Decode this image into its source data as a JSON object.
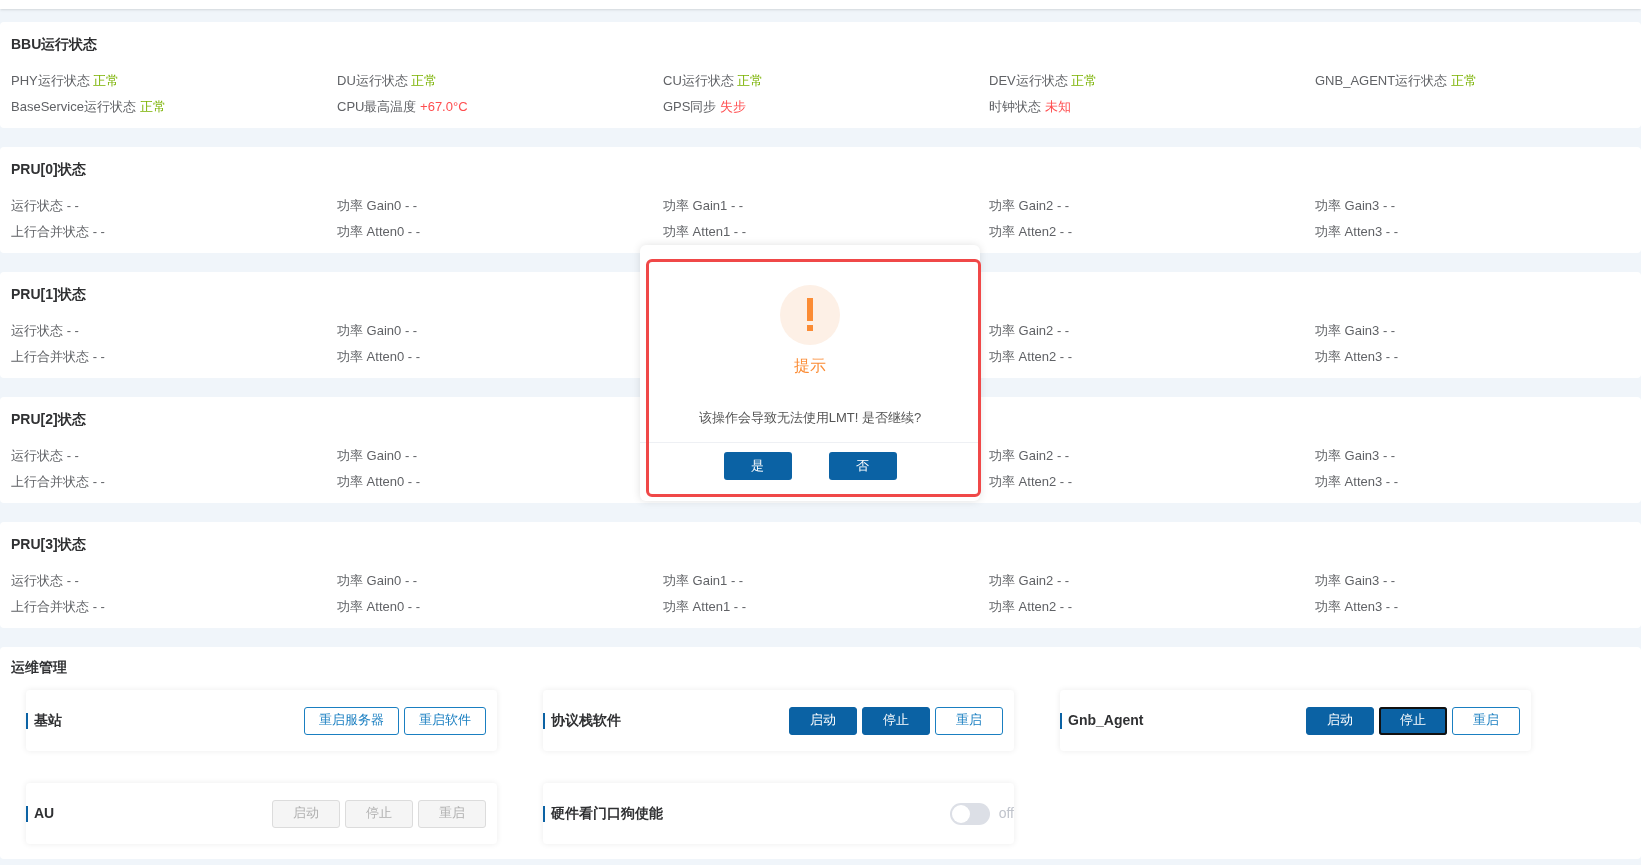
{
  "status_panels": [
    {
      "title": "BBU运行状态",
      "partly_hidden": false,
      "rows": [
        [
          {
            "label": "PHY运行状态",
            "value": "正常",
            "kind": "normal"
          },
          {
            "label": "DU运行状态",
            "value": "正常",
            "kind": "normal"
          },
          {
            "label": "CU运行状态",
            "value": "正常",
            "kind": "normal"
          },
          {
            "label": "DEV运行状态",
            "value": "正常",
            "kind": "normal"
          },
          {
            "label": "GNB_AGENT运行状态",
            "value": "正常",
            "kind": "normal"
          }
        ],
        [
          {
            "label": "BaseService运行状态",
            "value": "正常",
            "kind": "normal"
          },
          {
            "label": "CPU最高温度",
            "value": "+67.0°C",
            "kind": "alarm"
          },
          {
            "label": "GPS同步",
            "value": "失步",
            "kind": "alarm"
          },
          {
            "label": "时钟状态",
            "value": "未知",
            "kind": "alarm"
          }
        ]
      ]
    },
    {
      "title": "PRU[0]状态",
      "partly_hidden": false,
      "rows": [
        [
          {
            "label": "运行状态",
            "value": "- -",
            "kind": "empty"
          },
          {
            "label": "功率 Gain0",
            "value": "- -",
            "kind": "empty"
          },
          {
            "label": "功率 Gain1",
            "value": "- -",
            "kind": "empty"
          },
          {
            "label": "功率 Gain2",
            "value": "- -",
            "kind": "empty"
          },
          {
            "label": "功率 Gain3",
            "value": "- -",
            "kind": "empty"
          }
        ],
        [
          {
            "label": "上行合并状态",
            "value": "- -",
            "kind": "empty"
          },
          {
            "label": "功率 Atten0",
            "value": "- -",
            "kind": "empty"
          },
          {
            "label": "功率 Atten1",
            "value": "- -",
            "kind": "empty"
          },
          {
            "label": "功率 Atten2",
            "value": "- -",
            "kind": "empty"
          },
          {
            "label": "功率 Atten3",
            "value": "- -",
            "kind": "empty"
          }
        ]
      ]
    },
    {
      "title": "PRU[1]状态",
      "partly_hidden": true,
      "rows": [
        [
          {
            "label": "运行状态",
            "value": "- -",
            "kind": "empty"
          },
          {
            "label": "功率 Gain0",
            "value": "- -",
            "kind": "empty"
          },
          {
            "label": "功率 Gain2",
            "value": "- -",
            "kind": "empty"
          },
          {
            "label": "功率 Gain3",
            "value": "- -",
            "kind": "empty"
          }
        ],
        [
          {
            "label": "上行合并状态",
            "value": "- -",
            "kind": "empty"
          },
          {
            "label": "功率 Atten0",
            "value": "- -",
            "kind": "empty"
          },
          {
            "label": "功率 Atten2",
            "value": "- -",
            "kind": "empty"
          },
          {
            "label": "功率 Atten3",
            "value": "- -",
            "kind": "empty"
          }
        ]
      ]
    },
    {
      "title": "PRU[2]状态",
      "partly_hidden": true,
      "rows": [
        [
          {
            "label": "运行状态",
            "value": "- -",
            "kind": "empty"
          },
          {
            "label": "功率 Gain0",
            "value": "- -",
            "kind": "empty"
          },
          {
            "label": "功率 Gain2",
            "value": "- -",
            "kind": "empty"
          },
          {
            "label": "功率 Gain3",
            "value": "- -",
            "kind": "empty"
          }
        ],
        [
          {
            "label": "上行合并状态",
            "value": "- -",
            "kind": "empty"
          },
          {
            "label": "功率 Atten0",
            "value": "- -",
            "kind": "empty"
          },
          {
            "label": "功率 Atten2",
            "value": "- -",
            "kind": "empty"
          },
          {
            "label": "功率 Atten3",
            "value": "- -",
            "kind": "empty"
          }
        ]
      ]
    },
    {
      "title": "PRU[3]状态",
      "partly_hidden": false,
      "rows": [
        [
          {
            "label": "运行状态",
            "value": "- -",
            "kind": "empty"
          },
          {
            "label": "功率 Gain0",
            "value": "- -",
            "kind": "empty"
          },
          {
            "label": "功率 Gain1",
            "value": "- -",
            "kind": "empty"
          },
          {
            "label": "功率 Gain2",
            "value": "- -",
            "kind": "empty"
          },
          {
            "label": "功率 Gain3",
            "value": "- -",
            "kind": "empty"
          }
        ],
        [
          {
            "label": "上行合并状态",
            "value": "- -",
            "kind": "empty"
          },
          {
            "label": "功率 Atten0",
            "value": "- -",
            "kind": "empty"
          },
          {
            "label": "功率 Atten1",
            "value": "- -",
            "kind": "empty"
          },
          {
            "label": "功率 Atten2",
            "value": "- -",
            "kind": "empty"
          },
          {
            "label": "功率 Atten3",
            "value": "- -",
            "kind": "empty"
          }
        ]
      ]
    }
  ],
  "maintenance": {
    "title": "运维管理",
    "cards": [
      {
        "title": "基站",
        "kind": "buttons",
        "buttons": [
          {
            "label": "重启服务器",
            "kind": "outline",
            "disabled": false,
            "focused": false
          },
          {
            "label": "重启软件",
            "kind": "outline",
            "disabled": false,
            "focused": false
          }
        ]
      },
      {
        "title": "协议栈软件",
        "kind": "buttons",
        "buttons": [
          {
            "label": "启动",
            "kind": "filled",
            "disabled": false,
            "focused": false
          },
          {
            "label": "停止",
            "kind": "filled",
            "disabled": false,
            "focused": false
          },
          {
            "label": "重启",
            "kind": "outline",
            "disabled": false,
            "focused": false
          }
        ]
      },
      {
        "title": "Gnb_Agent",
        "kind": "buttons",
        "buttons": [
          {
            "label": "启动",
            "kind": "filled",
            "disabled": false,
            "focused": false
          },
          {
            "label": "停止",
            "kind": "filled",
            "disabled": false,
            "focused": true
          },
          {
            "label": "重启",
            "kind": "outline",
            "disabled": false,
            "focused": false
          }
        ]
      },
      {
        "title": "AU",
        "kind": "buttons",
        "buttons": [
          {
            "label": "启动",
            "kind": "outline",
            "disabled": true,
            "focused": false
          },
          {
            "label": "停止",
            "kind": "outline",
            "disabled": true,
            "focused": false
          },
          {
            "label": "重启",
            "kind": "outline",
            "disabled": true,
            "focused": false
          }
        ]
      },
      {
        "title": "硬件看门口狗使能",
        "kind": "switch",
        "on": false,
        "state_text": "off"
      }
    ]
  },
  "dialog": {
    "title": "提示",
    "message": "该操作会导致无法使用LMT! 是否继续?",
    "buttons": [
      "是",
      "否"
    ],
    "highlighted": true
  }
}
